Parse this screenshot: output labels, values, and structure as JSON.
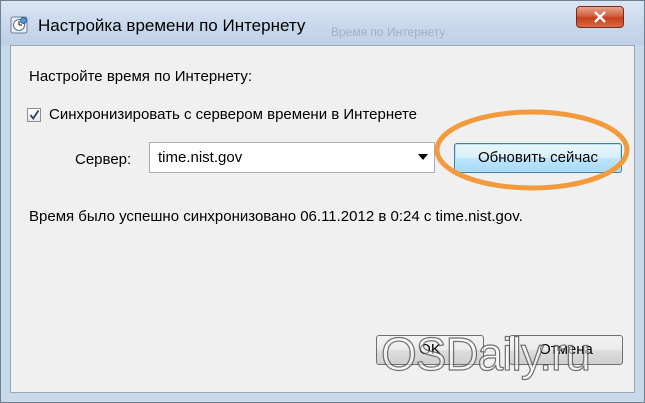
{
  "window": {
    "title": "Настройка времени по Интернету",
    "faded_text": "Время по Интернету"
  },
  "content": {
    "heading": "Настройте время по Интернету:",
    "sync_checkbox": {
      "label": "Синхронизировать с сервером времени в Интернете",
      "checked": true
    },
    "server_label": "Сервер:",
    "server_value": "time.nist.gov",
    "update_button": "Обновить сейчас",
    "status": "Время было успешно синхронизовано 06.11.2012 в 0:24 с time.nist.gov."
  },
  "buttons": {
    "ok": "OK",
    "cancel": "Отмена"
  },
  "watermark": "OSDaily.ru",
  "colors": {
    "highlight": "#f39a3c",
    "title_bar": "#c9d9ec",
    "panel": "#f0f0f0",
    "close_button": "#c2411c"
  },
  "icons": {
    "title": "clock-globe-icon",
    "close": "close-icon",
    "checkbox_mark": "checkmark-icon",
    "dropdown": "chevron-down-icon"
  }
}
